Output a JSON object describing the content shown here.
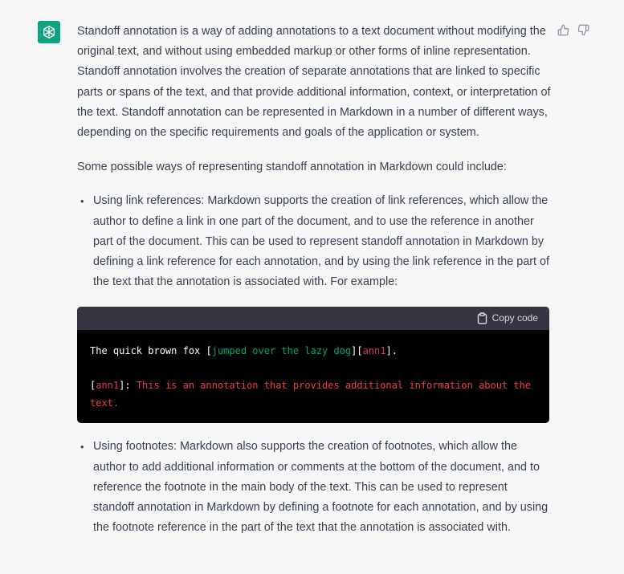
{
  "feedback": {
    "thumbs_up_icon": "thumbs-up",
    "thumbs_down_icon": "thumbs-down"
  },
  "message": {
    "paragraph1": "Standoff annotation is a way of adding annotations to a text document without modifying the original text, and without using embedded markup or other forms of inline representation. Standoff annotation involves the creation of separate annotations that are linked to specific parts or spans of the text, and that provide additional information, context, or interpretation of the text. Standoff annotation can be represented in Markdown in a number of different ways, depending on the specific requirements and goals of the application or system.",
    "paragraph2": "Some possible ways of representing standoff annotation in Markdown could include:",
    "bullet_char": "•",
    "bullet1": "Using link references: Markdown supports the creation of link references, which allow the author to define a link in one part of the document, and to use the reference in another part of the document. This can be used to represent standoff annotation in Markdown by defining a link reference for each annotation, and by using the link reference in the part of the text that the annotation is associated with. For example:",
    "bullet2": "Using footnotes: Markdown also supports the creation of footnotes, which allow the author to add additional information or comments at the bottom of the document, and to reference the footnote in the main body of the text. This can be used to represent standoff annotation in Markdown by defining a footnote for each annotation, and by using the footnote reference in the part of the text that the annotation is associated with."
  },
  "code": {
    "copy_label": "Copy code",
    "line1": {
      "plain": "The quick brown fox ",
      "open_bracket": "[",
      "link_text": "jumped over the lazy dog",
      "mid_bracket": "][",
      "ref": "ann1",
      "close": "]."
    },
    "line2": {
      "open_bracket": "[",
      "ref": "ann1",
      "close_colon": "]:",
      "definition": " This is an annotation that provides additional information about the text."
    }
  },
  "colors": {
    "avatar_bg": "#10a37f",
    "code_bg": "#000000",
    "code_header_bg": "#343541",
    "code_green": "#00a67d",
    "code_red": "#ef4146",
    "code_pink": "#df3079"
  }
}
